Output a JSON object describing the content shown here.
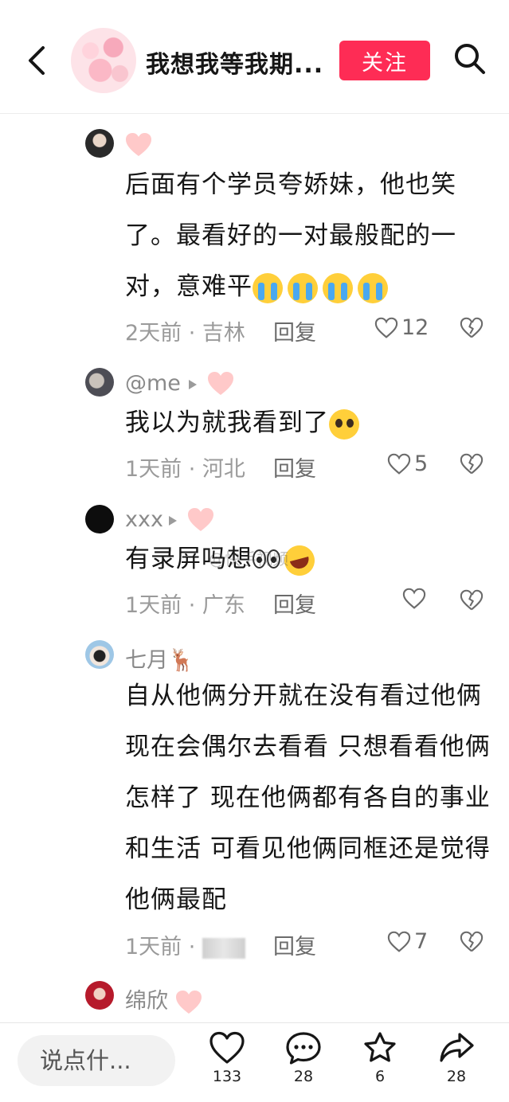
{
  "header": {
    "back_icon": "chevron-left-icon",
    "title": "我想我等我期...",
    "follow_label": "关注",
    "search_icon": "search-icon",
    "accent_color": "#fe2c55"
  },
  "comments": [
    {
      "name": "",
      "text": "后面有个学员夸娇妹，他也笑了。最看好的一对最般配的一对，意难平",
      "emoji": "loudly-crying-face x4",
      "meta": "2天前 · 吉林",
      "reply_label": "回复",
      "likes": "12"
    },
    {
      "name": "@me",
      "text": "我以为就我看到了",
      "emoji": "pleading-face",
      "meta": "1天前 · 河北",
      "reply_label": "回复",
      "likes": "5"
    },
    {
      "name": "xxx",
      "text": "有录屏吗想",
      "emoji": "eyes, rolling-on-floor-laughing",
      "meta": "1天前 · 广东",
      "reply_label": "回复",
      "likes": ""
    },
    {
      "name": "七月🦌",
      "text": "自从他俩分开就在没有看过他俩 现在会偶尔去看看 只想看看他俩怎样了 现在他俩都有各自的事业和生活 可看见他俩同框还是觉得他俩最配",
      "meta": "1天前 · ",
      "reply_label": "回复",
      "likes": "7"
    },
    {
      "name": "绵欣"
    }
  ],
  "watermark": "@快手视频",
  "bottom_bar": {
    "input_placeholder": "说点什...",
    "like_count": "133",
    "comment_count": "28",
    "favorite_count": "6",
    "share_count": "28"
  }
}
